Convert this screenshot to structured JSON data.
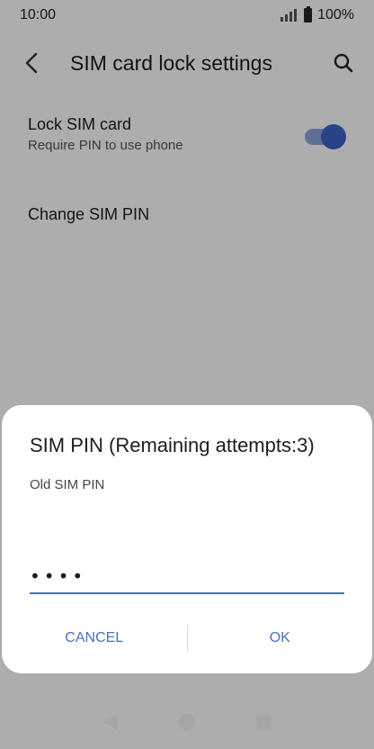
{
  "status_bar": {
    "time": "10:00",
    "battery": "100%",
    "icons": [
      "signal-icon",
      "battery-icon"
    ]
  },
  "app_bar": {
    "title": "SIM card lock settings",
    "icons": [
      "back-arrow-icon",
      "search-icon"
    ]
  },
  "settings": {
    "lock_sim": {
      "title": "Lock SIM card",
      "summary": "Require PIN to use phone",
      "enabled": true
    },
    "change_pin": {
      "title": "Change SIM PIN"
    }
  },
  "dialog": {
    "title": "SIM PIN (Remaining attempts:3)",
    "label": "Old SIM PIN",
    "input_value": "••••",
    "cancel_label": "CANCEL",
    "ok_label": "OK",
    "accent_color": "#4a6fbf"
  },
  "nav_bar": {
    "icons": [
      "back-triangle-icon",
      "home-circle-icon",
      "recents-square-icon"
    ]
  },
  "colors": {
    "toggle_on": "#3b64c8",
    "accent": "#4a6fbf"
  }
}
